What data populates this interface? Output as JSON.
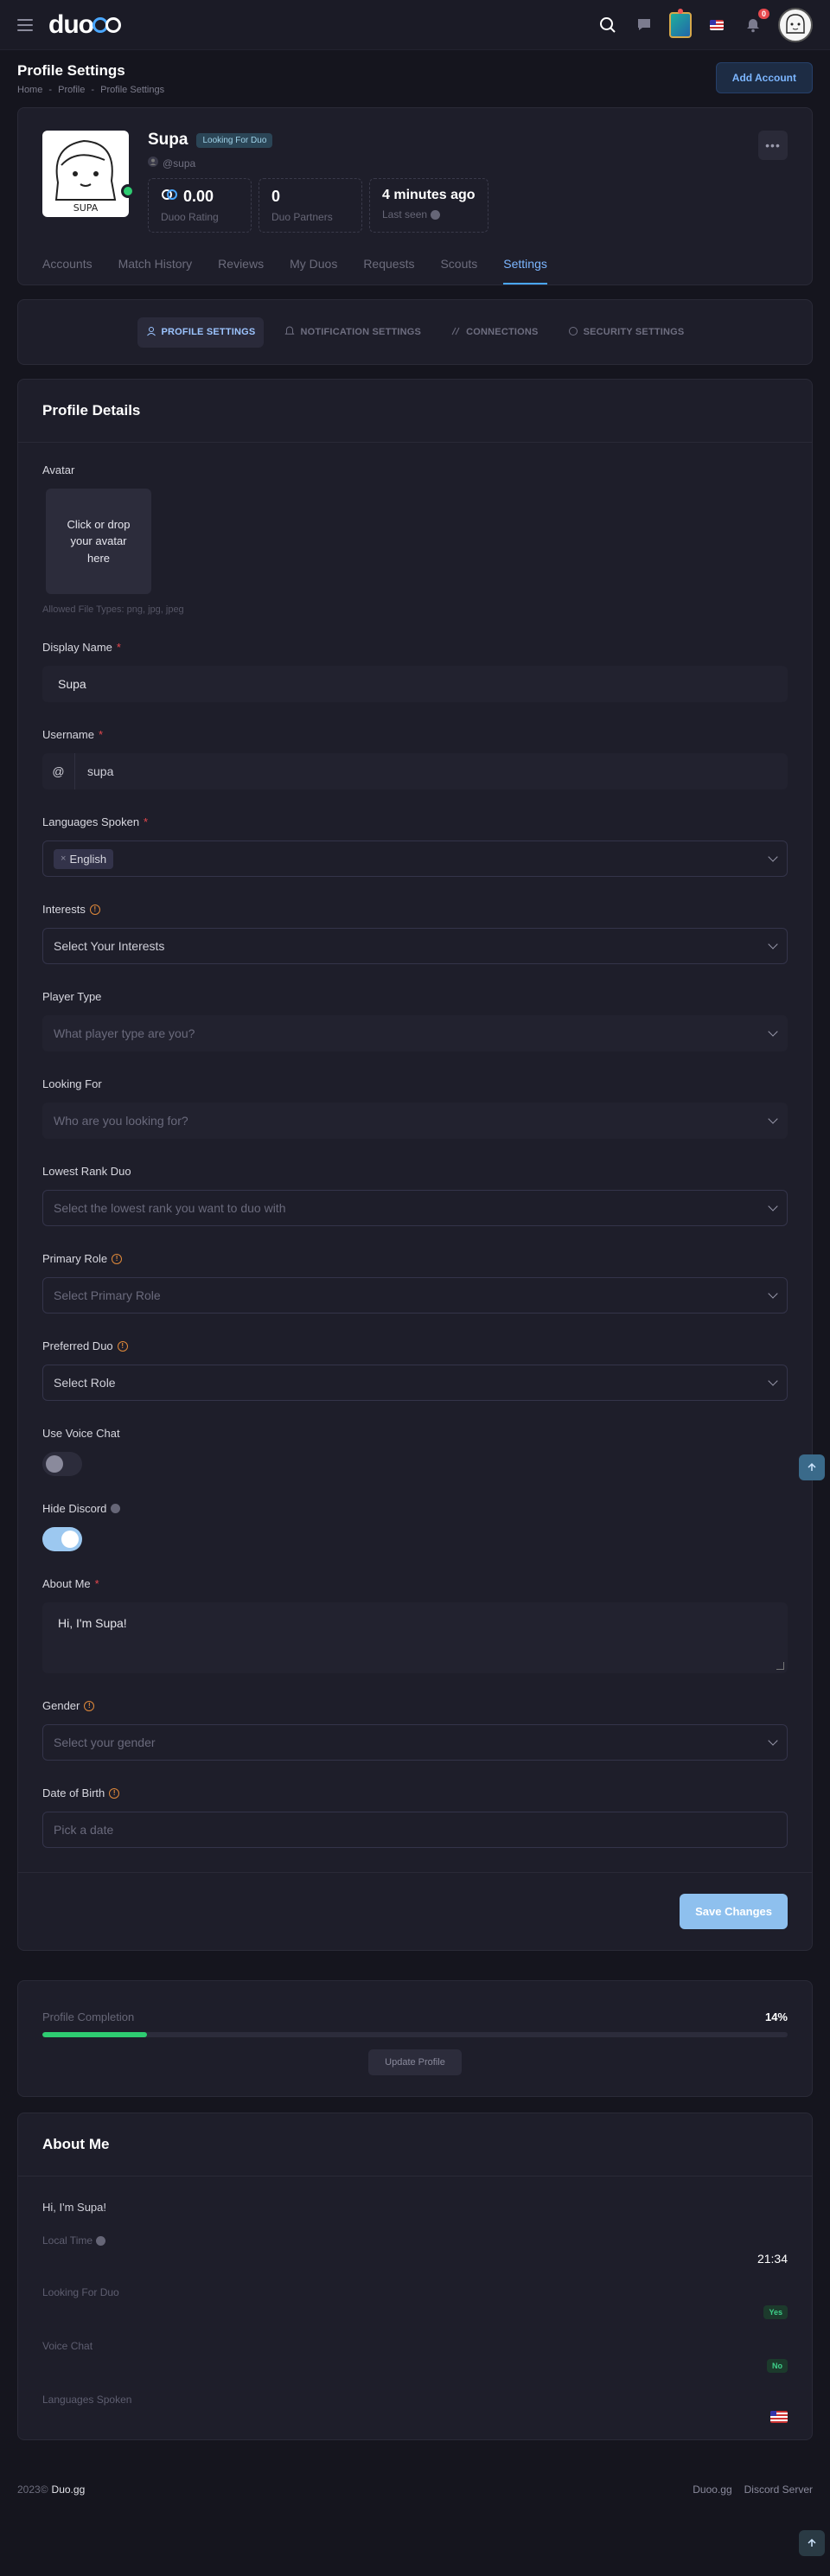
{
  "header": {
    "notification_count": "0",
    "logo_text": "duo"
  },
  "page": {
    "title": "Profile Settings",
    "breadcrumbs": [
      "Home",
      "-",
      "Profile",
      "-",
      "Profile Settings"
    ],
    "add_account_label": "Add Account"
  },
  "profile": {
    "name": "Supa",
    "status_badge": "Looking For Duo",
    "handle": "@supa",
    "avatar_caption": "SUPA",
    "stats": [
      {
        "value": "0.00",
        "label": "Duoo Rating"
      },
      {
        "value": "0",
        "label": "Duo Partners"
      },
      {
        "value": "4 minutes ago",
        "label": "Last seen"
      }
    ],
    "tabs": [
      "Accounts",
      "Match History",
      "Reviews",
      "My Duos",
      "Requests",
      "Scouts",
      "Settings"
    ],
    "active_tab": "Settings"
  },
  "settings_tabs": [
    {
      "label": "PROFILE SETTINGS",
      "active": true
    },
    {
      "label": "NOTIFICATION SETTINGS",
      "active": false
    },
    {
      "label": "CONNECTIONS",
      "active": false
    },
    {
      "label": "SECURITY SETTINGS",
      "active": false
    }
  ],
  "form": {
    "title": "Profile Details",
    "avatar": {
      "label": "Avatar",
      "drop_text": "Click or drop your avatar here",
      "hint": "Allowed File Types: png, jpg, jpeg"
    },
    "display_name": {
      "label": "Display Name",
      "value": "Supa"
    },
    "username": {
      "label": "Username",
      "prefix": "@",
      "value": "supa"
    },
    "languages": {
      "label": "Languages Spoken",
      "chips": [
        "English"
      ]
    },
    "interests": {
      "label": "Interests",
      "placeholder": "Select Your Interests"
    },
    "player_type": {
      "label": "Player Type",
      "placeholder": "What player type are you?"
    },
    "looking_for": {
      "label": "Looking For",
      "placeholder": "Who are you looking for?"
    },
    "lowest_rank": {
      "label": "Lowest Rank Duo",
      "placeholder": "Select the lowest rank you want to duo with"
    },
    "primary_role": {
      "label": "Primary Role",
      "placeholder": "Select Primary Role"
    },
    "preferred_duo": {
      "label": "Preferred Duo",
      "value": "Select Role"
    },
    "voice_chat": {
      "label": "Use Voice Chat",
      "on": false
    },
    "hide_discord": {
      "label": "Hide Discord",
      "on": true
    },
    "about_me": {
      "label": "About Me",
      "value": "Hi, I'm Supa!"
    },
    "gender": {
      "label": "Gender",
      "placeholder": "Select your gender"
    },
    "dob": {
      "label": "Date of Birth",
      "placeholder": "Pick a date"
    },
    "save_label": "Save Changes"
  },
  "completion": {
    "label": "Profile Completion",
    "percent_text": "14%",
    "percent": 14,
    "update_label": "Update Profile"
  },
  "about": {
    "title": "About Me",
    "text": "Hi, I'm Supa!",
    "rows": [
      {
        "label": "Local Time",
        "value": "21:34"
      },
      {
        "label": "Looking For Duo",
        "value": "Yes"
      },
      {
        "label": "Voice Chat",
        "value": "No"
      },
      {
        "label": "Languages Spoken",
        "value": ""
      }
    ]
  },
  "footer": {
    "year": "2023©",
    "brand": "Duo.gg",
    "links": [
      "Duoo.gg",
      "Discord Server"
    ]
  },
  "colors": {
    "accent": "#4aa7ff",
    "success": "#2ecc71",
    "danger": "#e5484d",
    "warning": "#e0893a"
  }
}
